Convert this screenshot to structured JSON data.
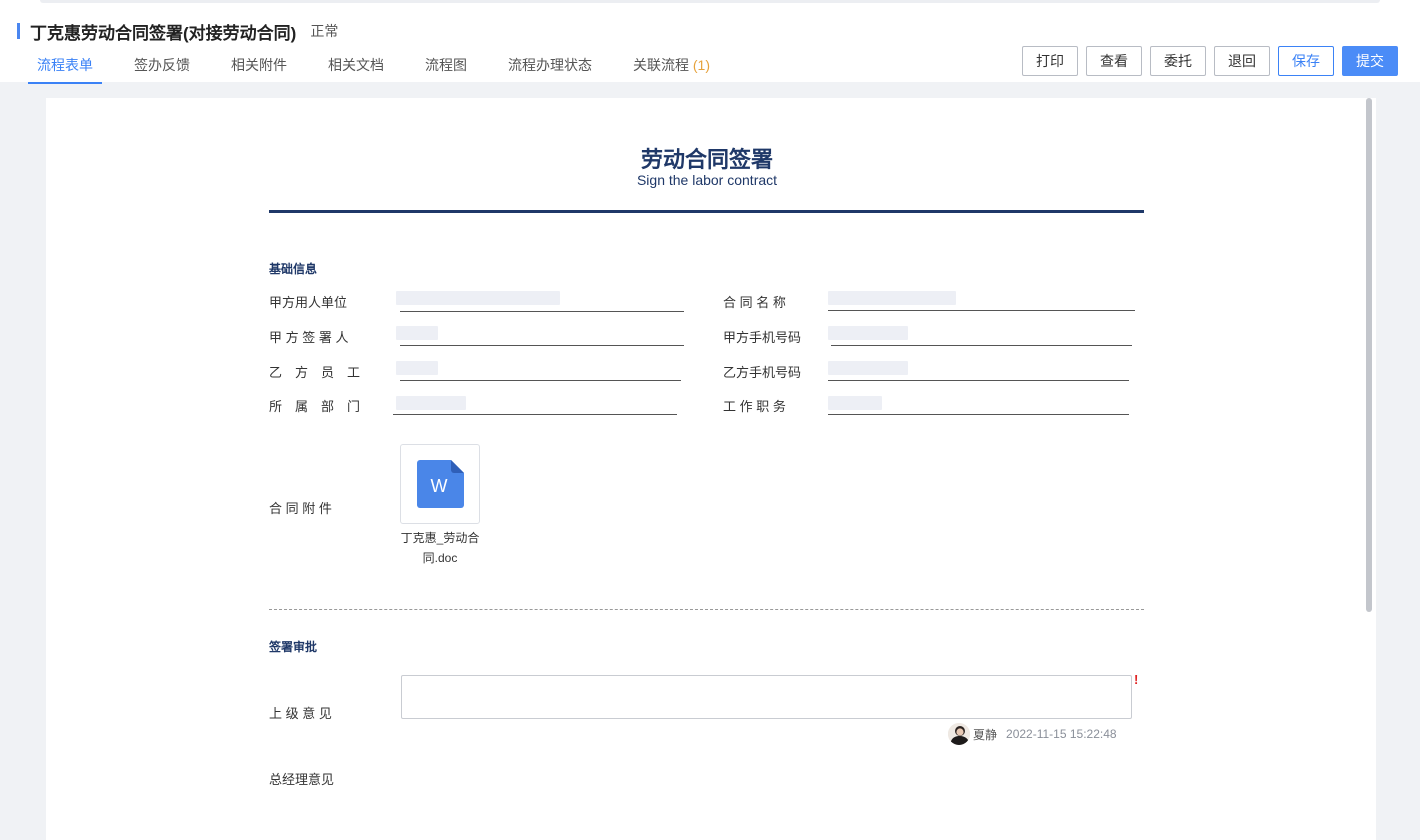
{
  "header": {
    "title": "丁克惠劳动合同签署(对接劳动合同)",
    "status": "正常",
    "tabs": [
      {
        "label": "流程表单"
      },
      {
        "label": "签办反馈"
      },
      {
        "label": "相关附件"
      },
      {
        "label": "相关文档"
      },
      {
        "label": "流程图"
      },
      {
        "label": "流程办理状态"
      },
      {
        "label": "关联流程",
        "count": "(1)"
      }
    ],
    "actions": {
      "print": "打印",
      "view": "查看",
      "delegate": "委托",
      "return": "退回",
      "save": "保存",
      "submit": "提交"
    }
  },
  "document": {
    "title": "劳动合同签署",
    "subtitle": "Sign the labor contract",
    "basic_section": "基础信息",
    "fields": {
      "employer_unit": "甲方用人单位",
      "contract_name": "合 同 名 称",
      "party_a_signer": "甲 方 签 署 人",
      "party_a_phone": "甲方手机号码",
      "party_b_employee": "乙　方　员　工",
      "party_b_phone": "乙方手机号码",
      "department": "所　属　部　门",
      "job_position": "工 作 职 务",
      "contract_attachment": "合 同 附 件"
    },
    "attachment": {
      "icon_letter": "W",
      "filename": "丁克惠_劳动合同.doc"
    },
    "approval_section": "签署审批",
    "approval": {
      "supervisor_label": "上 级 意 见",
      "supervisor_required": "!",
      "signer_name": "夏静",
      "signed_at": "2022-11-15 15:22:48",
      "gm_label": "总经理意见"
    }
  },
  "colors": {
    "accent": "#3b82f6",
    "submit": "#4b8cf7",
    "doc_navy": "#1f3868",
    "tab_count": "#e6a23c",
    "word_blue": "#4a86e8",
    "required": "#e02424"
  }
}
